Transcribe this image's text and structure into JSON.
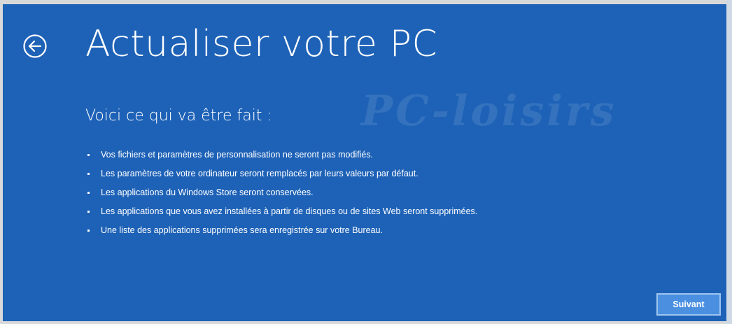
{
  "header": {
    "back_icon": "back-arrow-circle-icon",
    "title": "Actualiser votre PC"
  },
  "watermark": "PC-loisirs",
  "main": {
    "subtitle": "Voici ce qui va être fait :",
    "items": [
      "Vos fichiers et paramètres de personnalisation ne seront pas modifiés.",
      "Les paramètres de votre ordinateur seront remplacés par leurs valeurs par défaut.",
      "Les applications du Windows Store seront conservées.",
      "Les applications que vous avez installées à partir de disques ou de sites Web seront supprimées.",
      "Une liste des applications supprimées sera enregistrée sur votre Bureau."
    ]
  },
  "footer": {
    "next_label": "Suivant"
  },
  "colors": {
    "background": "#1e62b7",
    "text": "#ffffff",
    "button": "#4a8fe0",
    "button_border": "#9ec4f0"
  }
}
